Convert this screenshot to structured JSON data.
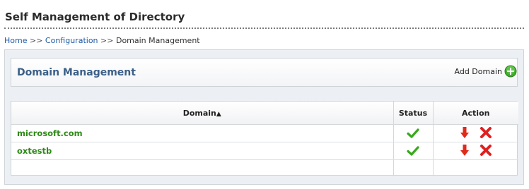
{
  "page": {
    "title": "Self Management of Directory"
  },
  "breadcrumb": {
    "items": [
      "Home",
      "Configuration",
      "Domain Management"
    ],
    "separator": ">>"
  },
  "header": {
    "title": "Domain Management",
    "add_label": "Add Domain"
  },
  "table": {
    "columns": [
      "Domain",
      "Status",
      "Action"
    ],
    "sort_indicator": "▲",
    "rows": [
      {
        "domain": "microsoft.com",
        "status": "check-icon",
        "actions": [
          "move-down-icon",
          "delete-icon"
        ]
      },
      {
        "domain": "oxtestb",
        "status": "check-icon",
        "actions": [
          "move-down-icon",
          "delete-icon"
        ]
      }
    ]
  },
  "colors": {
    "accent_green": "#2d8a16",
    "header_blue": "#3b5f87",
    "link_blue": "#1f5aa6",
    "delete_red": "#e02020"
  }
}
